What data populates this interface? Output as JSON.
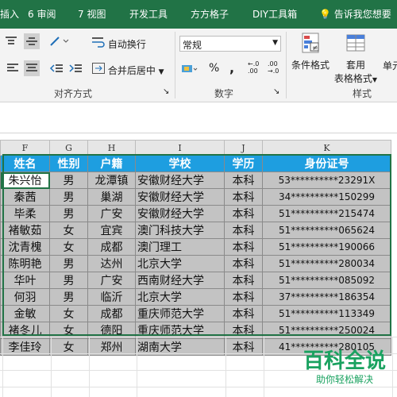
{
  "tabs": [
    "6 审阅",
    "7 视图",
    "开发工具",
    "方方格子",
    "DIY工具箱"
  ],
  "tab_partial": "插入",
  "tell_me": "告诉我您想要",
  "ribbon": {
    "wrap_text": "自动换行",
    "merge_center": "合并后居中",
    "number_format": "常规",
    "percent": "%",
    "comma": ",",
    "inc_decimal": "←.0\n.00",
    "dec_decimal": ".00\n→.0",
    "cond_format": "条件格式",
    "table_format_1": "套用",
    "table_format_2": "表格格式",
    "cell_style_partial": "单元",
    "group_alignment": "对齐方式",
    "group_number": "数字",
    "group_styles": "样式"
  },
  "columns": [
    "F",
    "G",
    "H",
    "I",
    "J",
    "K"
  ],
  "headers": [
    "姓名",
    "性别",
    "户籍",
    "学校",
    "学历",
    "身份证号"
  ],
  "rows": [
    [
      "朱兴怡",
      "男",
      "龙潭镇",
      "安徽财经大学",
      "本科",
      "53**********23291X"
    ],
    [
      "秦茜",
      "男",
      "巢湖",
      "安徽财经大学",
      "本科",
      "34**********150299"
    ],
    [
      "毕柔",
      "男",
      "广安",
      "安徽财经大学",
      "本科",
      "51**********215474"
    ],
    [
      "褚敏茹",
      "女",
      "宜宾",
      "澳门科技大学",
      "本科",
      "51**********065624"
    ],
    [
      "沈青槐",
      "女",
      "成都",
      "澳门理工",
      "本科",
      "51**********190066"
    ],
    [
      "陈明艳",
      "男",
      "达州",
      "北京大学",
      "本科",
      "51**********280034"
    ],
    [
      "华叶",
      "男",
      "广安",
      "西南财经大学",
      "本科",
      "51**********085092"
    ],
    [
      "何羽",
      "男",
      "临沂",
      "北京大学",
      "本科",
      "37**********186354"
    ],
    [
      "金敏",
      "女",
      "成都",
      "重庆师范大学",
      "本科",
      "51**********113349"
    ],
    [
      "褚冬儿",
      "女",
      "德阳",
      "重庆师范大学",
      "本科",
      "51**********250024"
    ],
    [
      "李佳玲",
      "女",
      "郑州",
      "湖南大学",
      "本科",
      "41**********280105"
    ]
  ],
  "watermark": {
    "main": "百科全说",
    "sub": "助你轻松解决"
  },
  "colors": {
    "ribbon_green": "#217346",
    "header_fill": "#1e9ee0",
    "selection_gray": "#c3c3c3",
    "watermark_green": "#1aa260"
  }
}
